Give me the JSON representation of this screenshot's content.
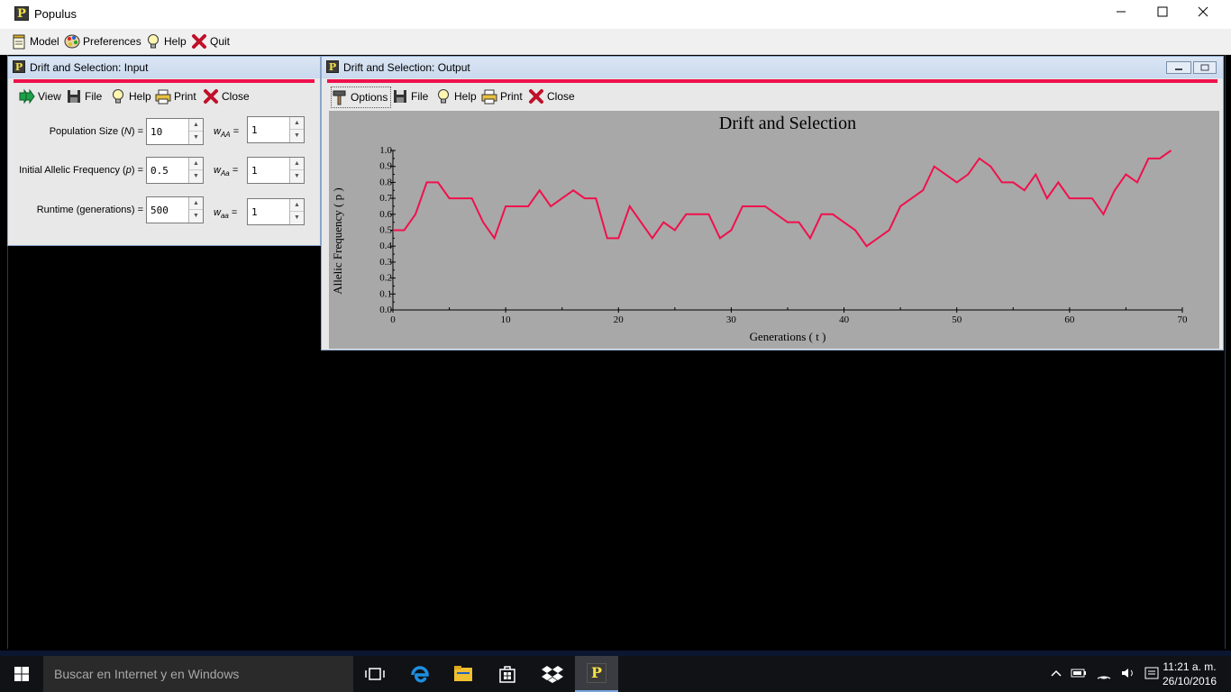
{
  "app": {
    "title": "Populus",
    "logo_glyph": "P"
  },
  "menu": {
    "model": "Model",
    "preferences": "Preferences",
    "help": "Help",
    "quit": "Quit"
  },
  "input_window": {
    "title": "Drift and Selection: Input",
    "toolbar": {
      "view": "View",
      "file": "File",
      "help": "Help",
      "print": "Print",
      "close": "Close"
    },
    "fields": {
      "population_size_label": "Population Size (",
      "population_size_var": "N",
      "population_size_suffix": ") =",
      "population_size_value": "10",
      "initial_freq_label": "Initial Allelic Frequency (",
      "initial_freq_var": "p",
      "initial_freq_suffix": ") =",
      "initial_freq_value": "0.5",
      "runtime_label": "Runtime (generations) =",
      "runtime_value": "500",
      "w_AA_sym": "w",
      "w_AA_sub": "AA",
      "w_AA_value": "1",
      "w_Aa_sym": "w",
      "w_Aa_sub": "Aa",
      "w_Aa_value": "1",
      "w_aa_sym": "w",
      "w_aa_sub": "aa",
      "w_aa_value": "1",
      "equals": "="
    }
  },
  "output_window": {
    "title": "Drift and Selection: Output",
    "toolbar": {
      "options": "Options",
      "file": "File",
      "help": "Help",
      "print": "Print",
      "close": "Close"
    }
  },
  "chart_data": {
    "type": "line",
    "title": "Drift and Selection",
    "xlabel": "Generations ( t )",
    "ylabel": "Allelic Frequency ( p )",
    "xlim": [
      0,
      70
    ],
    "ylim": [
      0,
      1
    ],
    "x_ticks": [
      "0",
      "10",
      "20",
      "30",
      "40",
      "50",
      "60",
      "70"
    ],
    "y_ticks": [
      "0.0",
      "0.1",
      "0.2",
      "0.3",
      "0.4",
      "0.5",
      "0.6",
      "0.7",
      "0.8",
      "0.9",
      "1.0"
    ],
    "line_color": "#f0104c",
    "background": "#a8a8a8",
    "series": [
      {
        "x": [
          0,
          1,
          2,
          3,
          4,
          5,
          6,
          7,
          8,
          9,
          10,
          11,
          12,
          13,
          14,
          15,
          16,
          17,
          18,
          19,
          20,
          21,
          22,
          23,
          24,
          25,
          26,
          27,
          28,
          29,
          30,
          31,
          32,
          33,
          34,
          35,
          36,
          37,
          38,
          39,
          40,
          41,
          42,
          43,
          44,
          45,
          46,
          47,
          48,
          49,
          50,
          51,
          52,
          53,
          54,
          55,
          56,
          57,
          58,
          59,
          60,
          61,
          62,
          63,
          64,
          65,
          66,
          67,
          68,
          69
        ],
        "values": [
          0.5,
          0.5,
          0.6,
          0.8,
          0.8,
          0.7,
          0.7,
          0.7,
          0.55,
          0.45,
          0.65,
          0.65,
          0.65,
          0.75,
          0.65,
          0.7,
          0.75,
          0.7,
          0.7,
          0.45,
          0.45,
          0.65,
          0.55,
          0.45,
          0.55,
          0.5,
          0.6,
          0.6,
          0.6,
          0.45,
          0.5,
          0.65,
          0.65,
          0.65,
          0.6,
          0.55,
          0.55,
          0.45,
          0.6,
          0.6,
          0.55,
          0.5,
          0.4,
          0.45,
          0.5,
          0.65,
          0.7,
          0.75,
          0.9,
          0.85,
          0.8,
          0.85,
          0.95,
          0.9,
          0.8,
          0.8,
          0.75,
          0.85,
          0.7,
          0.8,
          0.7,
          0.7,
          0.7,
          0.6,
          0.75,
          0.85,
          0.8,
          0.95,
          0.95,
          1.0
        ]
      }
    ]
  },
  "taskbar": {
    "search_placeholder": "Buscar en Internet y en Windows",
    "time": "11:21 a. m.",
    "date": "26/10/2016"
  }
}
